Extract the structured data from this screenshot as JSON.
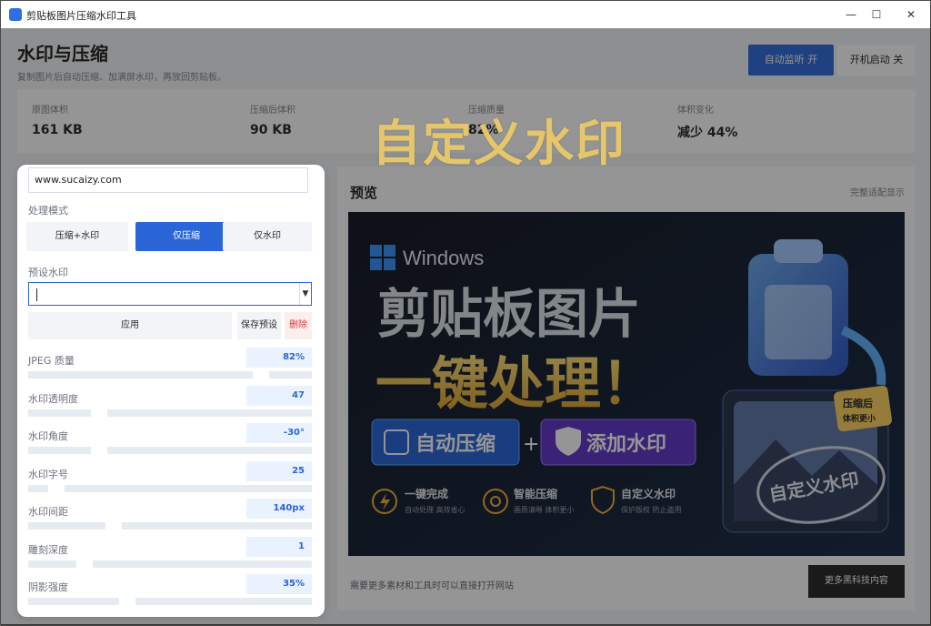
{
  "window": {
    "title": "剪贴板图片压缩水印工具",
    "controls": {
      "minimize": "—",
      "maximize": "☐",
      "close": "✕"
    }
  },
  "header": {
    "title": "水印与压缩",
    "subtitle": "复制图片后自动压缩、加满屏水印，再放回剪贴板。",
    "auto_monitor_btn": "自动监听  开",
    "autostart_btn": "开机启动  关"
  },
  "overlay_title": "自定义水印",
  "stats": [
    {
      "label": "原图体积",
      "value": "161 KB"
    },
    {
      "label": "压缩后体积",
      "value": "90 KB"
    },
    {
      "label": "压缩质量",
      "value": "82%"
    },
    {
      "label": "体积变化",
      "value": "减少 44%"
    }
  ],
  "left_panel": {
    "url_value": "www.sucaizy.com",
    "mode_label": "处理模式",
    "modes": [
      "压缩+水印",
      "仅压缩",
      "仅水印"
    ],
    "active_mode_index": 1,
    "preset_label": "预设水印",
    "preset_value": "",
    "apply_btn": "应用",
    "save_preset_btn": "保存预设",
    "delete_btn": "删除",
    "settings": [
      {
        "label": "JPEG 质量",
        "value": "82%",
        "level": 0.82
      },
      {
        "label": "水印透明度",
        "value": "47",
        "level": 0.25
      },
      {
        "label": "水印角度",
        "value": "-30°",
        "level": 0.25
      },
      {
        "label": "水印字号",
        "value": "25",
        "level": 0.1
      },
      {
        "label": "水印间距",
        "value": "140px",
        "level": 0.3
      },
      {
        "label": "雕刻深度",
        "value": "1",
        "level": 0.2
      },
      {
        "label": "阴影强度",
        "value": "35%",
        "level": 0.35
      }
    ]
  },
  "preview": {
    "title": "预览",
    "fit_label": "完整适配显示",
    "image": {
      "brand": "Windows",
      "headline1": "剪贴板图片",
      "headline2": "一键处理！",
      "badge1": "自动压缩",
      "plus": "+",
      "badge2": "添加水印",
      "corner_badge": "压缩后\n体积更小",
      "stamp": "自定义水印",
      "features": [
        {
          "title": "一键完成",
          "desc": "自动处理 高效省心"
        },
        {
          "title": "智能压缩",
          "desc": "画质清晰 体积更小"
        },
        {
          "title": "自定义水印",
          "desc": "保护版权 防止盗用"
        }
      ]
    },
    "footer_text": "需要更多素材和工具时可以直接打开网站",
    "more_btn": "更多黑科技内容"
  }
}
